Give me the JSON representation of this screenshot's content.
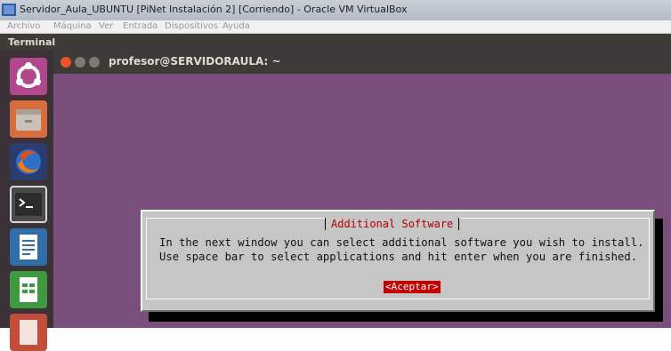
{
  "window": {
    "title": "Servidor_Aula_UBUNTU [PiNet Instalación 2] [Corriendo] - Oracle VM VirtualBox",
    "menu": [
      "Archivo",
      "Máquina",
      "Ver",
      "Entrada",
      "Dispositivos",
      "Ayuda"
    ]
  },
  "panel": {
    "app_title": "Terminal"
  },
  "launcher": {
    "items": [
      {
        "icon": "ubuntu-dash-icon"
      },
      {
        "icon": "files-icon"
      },
      {
        "icon": "firefox-icon"
      },
      {
        "icon": "terminal-icon",
        "active": true
      },
      {
        "icon": "libreoffice-writer-icon"
      },
      {
        "icon": "libreoffice-calc-icon"
      },
      {
        "icon": "libreoffice-impress-icon"
      }
    ]
  },
  "terminal": {
    "title": "profesor@SERVIDORAULA: ~"
  },
  "dialog": {
    "title": "Additional Software",
    "line1": "In the next window you can select additional software you wish to install.",
    "line2": "Use space bar to select applications and hit enter when you are finished.",
    "button_label": "<Aceptar>"
  },
  "colors": {
    "desktop": "#7a4f7c",
    "dialog_bg": "#c6c6c6",
    "accent_red": "#c40000",
    "launcher_bg": "#3a3236"
  }
}
